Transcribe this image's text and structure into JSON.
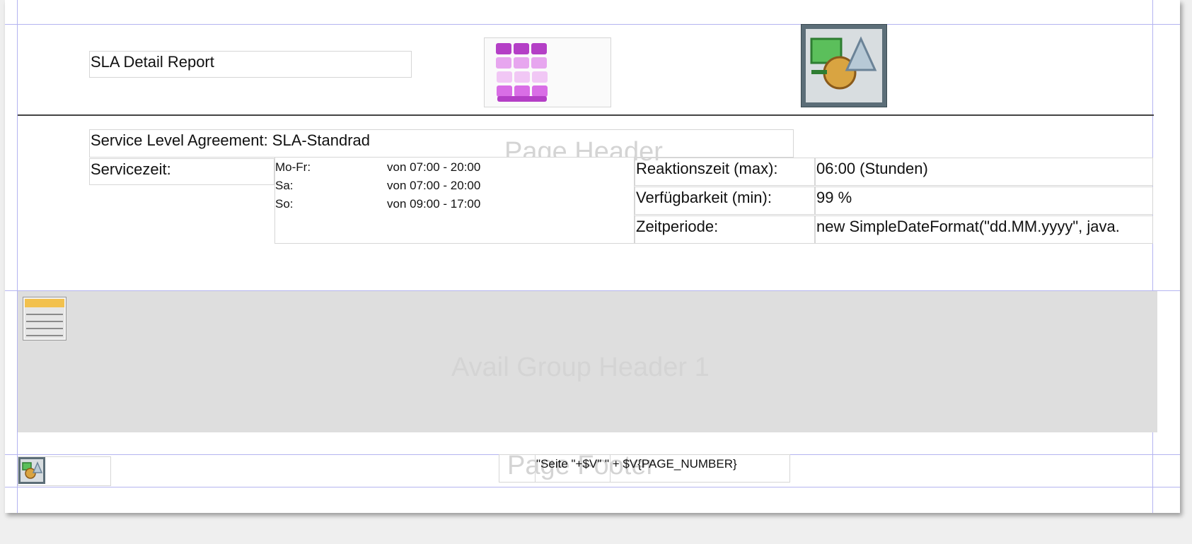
{
  "report": {
    "title": "SLA Detail Report",
    "sla_label": "Service Level Agreement: SLA-Standrad",
    "servicezeit_label": "Servicezeit:",
    "schedule": [
      {
        "day": "Mo-Fr:",
        "time": "von 07:00 - 20:00"
      },
      {
        "day": "Sa:",
        "time": "von 07:00 - 20:00"
      },
      {
        "day": "So:",
        "time": "von 09:00 - 17:00"
      }
    ],
    "reaktion_label": "Reaktionszeit (max):",
    "reaktion_value": "06:00 (Stunden)",
    "verfuegbarkeit_label": "Verfügbarkeit (min):",
    "verfuegbarkeit_value": "99 %",
    "zeitperiode_label": "Zeitperiode:",
    "zeitperiode_value": "new SimpleDateFormat(\"dd.MM.yyyy\", java.",
    "page_number_expr": "\"Seite \"+$V\" \" + $V{PAGE_NUMBER}"
  },
  "bands": {
    "page_header": "Page Header",
    "group_header": "Avail Group Header 1",
    "page_footer": "Page Footer"
  },
  "icons": {
    "table_icon": "table-grid-icon",
    "chart_icon": "shapes-chart-icon",
    "subreport_icon": "subreport-icon",
    "footer_chart_icon": "shapes-chart-small-icon"
  },
  "colors": {
    "guide": "#b4b4f0",
    "band_bg": "#dedede",
    "magenta": "#cc55dd"
  }
}
